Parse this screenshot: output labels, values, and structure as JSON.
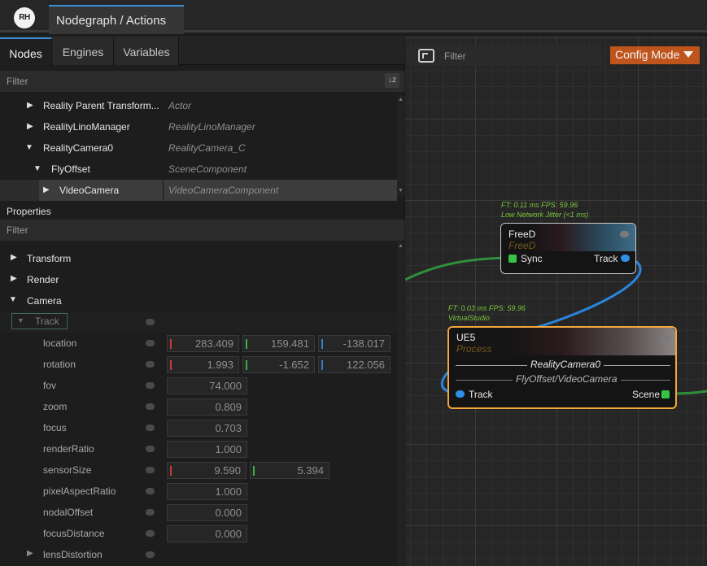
{
  "app": {
    "logo": "RH",
    "tab_title": "Nodegraph / Actions"
  },
  "left": {
    "tabs": [
      "Nodes",
      "Engines",
      "Variables"
    ],
    "filter_placeholder": "Filter",
    "sort_icon": "sort-az-icon",
    "tree": [
      {
        "name": "Reality Parent Transform...",
        "type": "Actor",
        "expanded": false,
        "depth": 0
      },
      {
        "name": "RealityLinoManager",
        "type": "RealityLinoManager",
        "expanded": false,
        "depth": 0
      },
      {
        "name": "RealityCamera0",
        "type": "RealityCamera_C",
        "expanded": true,
        "depth": 0
      },
      {
        "name": "FlyOffset",
        "type": "SceneComponent",
        "expanded": true,
        "depth": 1
      },
      {
        "name": "VideoCamera",
        "type": "VideoCameraComponent",
        "expanded": false,
        "depth": 2,
        "selected": true
      }
    ],
    "properties_title": "Properties",
    "properties_filter": "Filter",
    "groups": [
      "Transform",
      "Render",
      "Camera"
    ],
    "track_label": "Track",
    "props": [
      {
        "label": "location",
        "values": [
          "283.409",
          "159.481",
          "-138.017"
        ]
      },
      {
        "label": "rotation",
        "values": [
          "1.993",
          "-1.652",
          "122.056"
        ]
      },
      {
        "label": "fov",
        "values": [
          "74.000"
        ]
      },
      {
        "label": "zoom",
        "values": [
          "0.809"
        ]
      },
      {
        "label": "focus",
        "values": [
          "0.703"
        ]
      },
      {
        "label": "renderRatio",
        "values": [
          "1.000"
        ]
      },
      {
        "label": "sensorSize",
        "values": [
          "9.590",
          "5.394"
        ]
      },
      {
        "label": "pixelAspectRatio",
        "values": [
          "1.000"
        ]
      },
      {
        "label": "nodalOffset",
        "values": [
          "0.000"
        ]
      },
      {
        "label": "focusDistance",
        "values": [
          "0.000"
        ]
      },
      {
        "label": "lensDistortion",
        "values": []
      }
    ],
    "axis_colors": [
      "#c73a3a",
      "#3fae4a",
      "#3a7fc4"
    ]
  },
  "graph": {
    "filter_placeholder": "Filter",
    "config_label": "Config Mode",
    "fit_icon": "fit-view-icon",
    "nodes": {
      "freed": {
        "stats1": "FT: 0.11 ms FPS: 59.96",
        "stats2": "Low Network Jitter (<1 ms)",
        "title": "FreeD",
        "subtitle": "FreeD",
        "in_pin": "Sync",
        "out_pin": "Track"
      },
      "ue5": {
        "stats1": "FT: 0.03 ms FPS: 59.96",
        "stats2": "VirtualStudio",
        "title": "UE5",
        "subtitle": "Process",
        "line1": "RealityCamera0",
        "line2": "FlyOffset/VideoCamera",
        "in_pin": "Track",
        "out_pin": "Scene",
        "border_color": "#f2a73b"
      }
    }
  }
}
